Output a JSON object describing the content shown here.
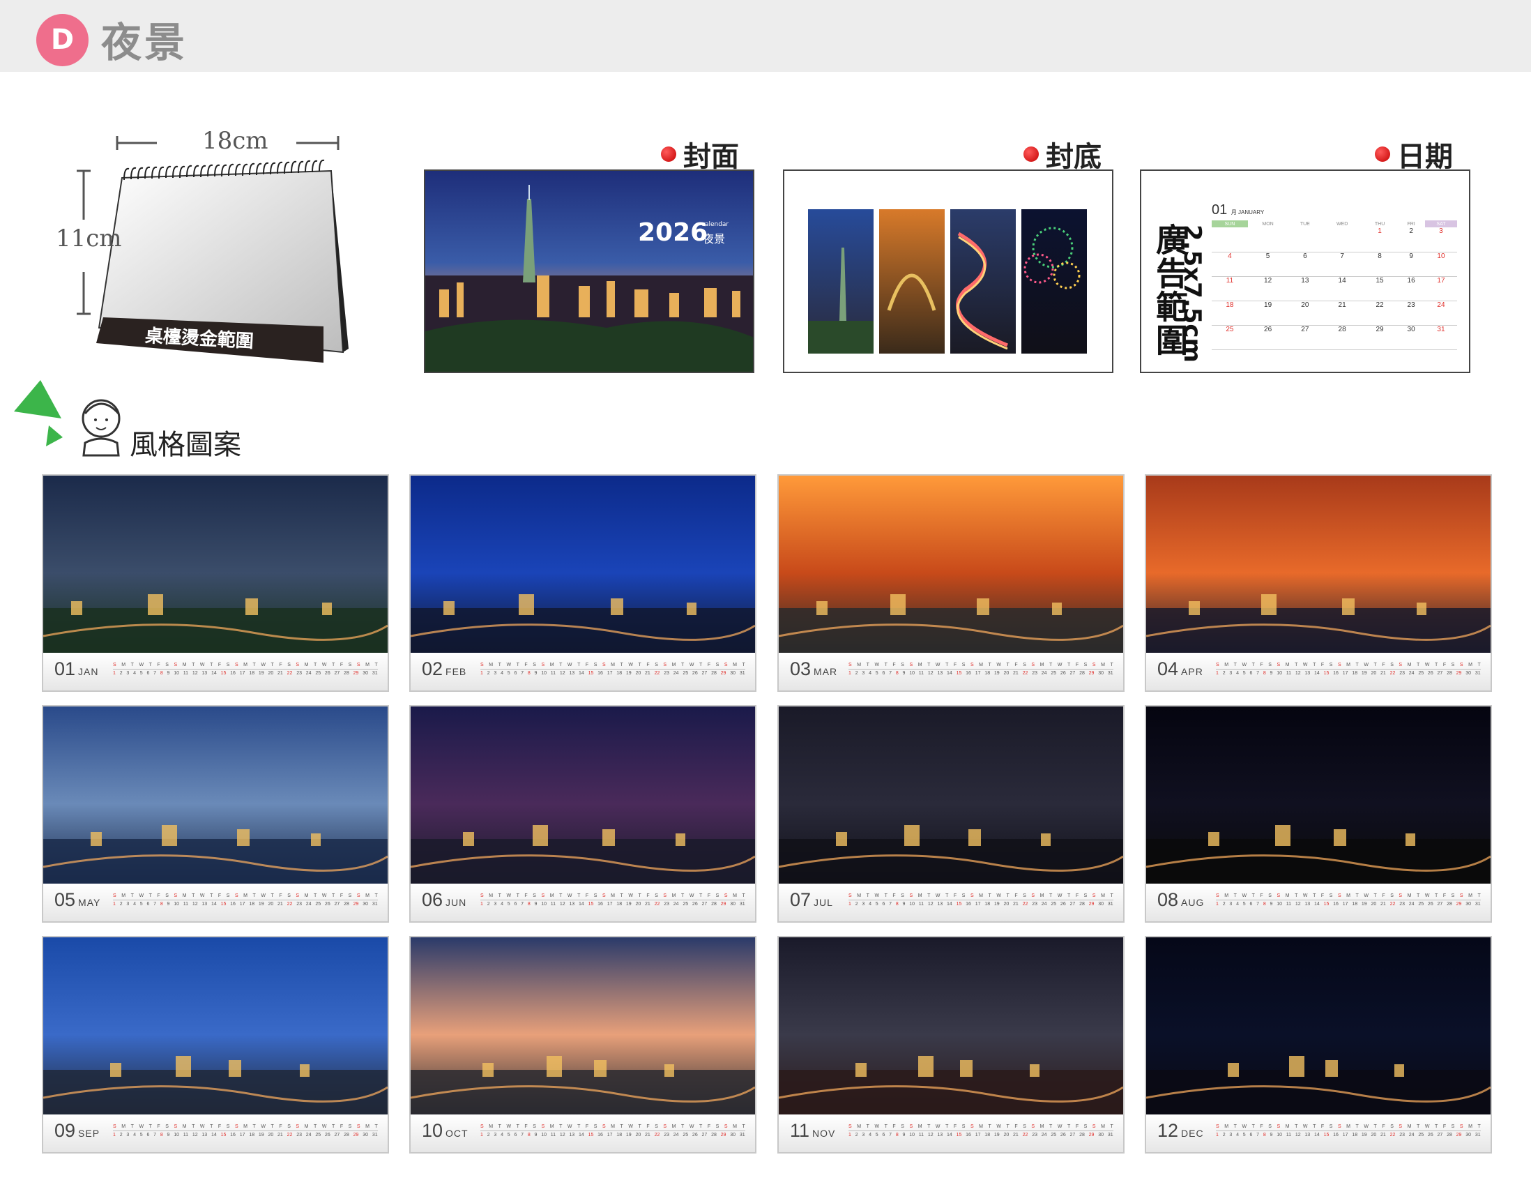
{
  "header": {
    "badge": "D",
    "title": "夜景"
  },
  "desk": {
    "width_label": "18cm",
    "height_label": "11cm",
    "stamp_label": "桌檯燙金範圍"
  },
  "sections": {
    "cover": "封面",
    "back": "封底",
    "date": "日期"
  },
  "cover": {
    "year": "2026",
    "small": "calendar",
    "name": "夜景"
  },
  "ad_panel": {
    "ad_text": "廣告範圍",
    "size_text": "2.5x7.5cm",
    "month_num": "01",
    "month_small": "月 JANUARY",
    "weekdays": [
      "SUN",
      "MON",
      "TUE",
      "WED",
      "THU",
      "FRI",
      "SAT"
    ],
    "days": [
      [
        "",
        "",
        "",
        "",
        "1",
        "2",
        "3"
      ],
      [
        "4",
        "5",
        "6",
        "7",
        "8",
        "9",
        "10"
      ],
      [
        "11",
        "12",
        "13",
        "14",
        "15",
        "16",
        "17"
      ],
      [
        "18",
        "19",
        "20",
        "21",
        "22",
        "23",
        "24"
      ],
      [
        "25",
        "26",
        "27",
        "28",
        "29",
        "30",
        "31"
      ]
    ]
  },
  "style_title": "風格圖案",
  "months": [
    {
      "num": "01",
      "name": "JAN"
    },
    {
      "num": "02",
      "name": "FEB"
    },
    {
      "num": "03",
      "name": "MAR"
    },
    {
      "num": "04",
      "name": "APR"
    },
    {
      "num": "05",
      "name": "MAY"
    },
    {
      "num": "06",
      "name": "JUN"
    },
    {
      "num": "07",
      "name": "JUL"
    },
    {
      "num": "08",
      "name": "AUG"
    },
    {
      "num": "09",
      "name": "SEP"
    },
    {
      "num": "10",
      "name": "OCT"
    },
    {
      "num": "11",
      "name": "NOV"
    },
    {
      "num": "12",
      "name": "DEC"
    }
  ]
}
